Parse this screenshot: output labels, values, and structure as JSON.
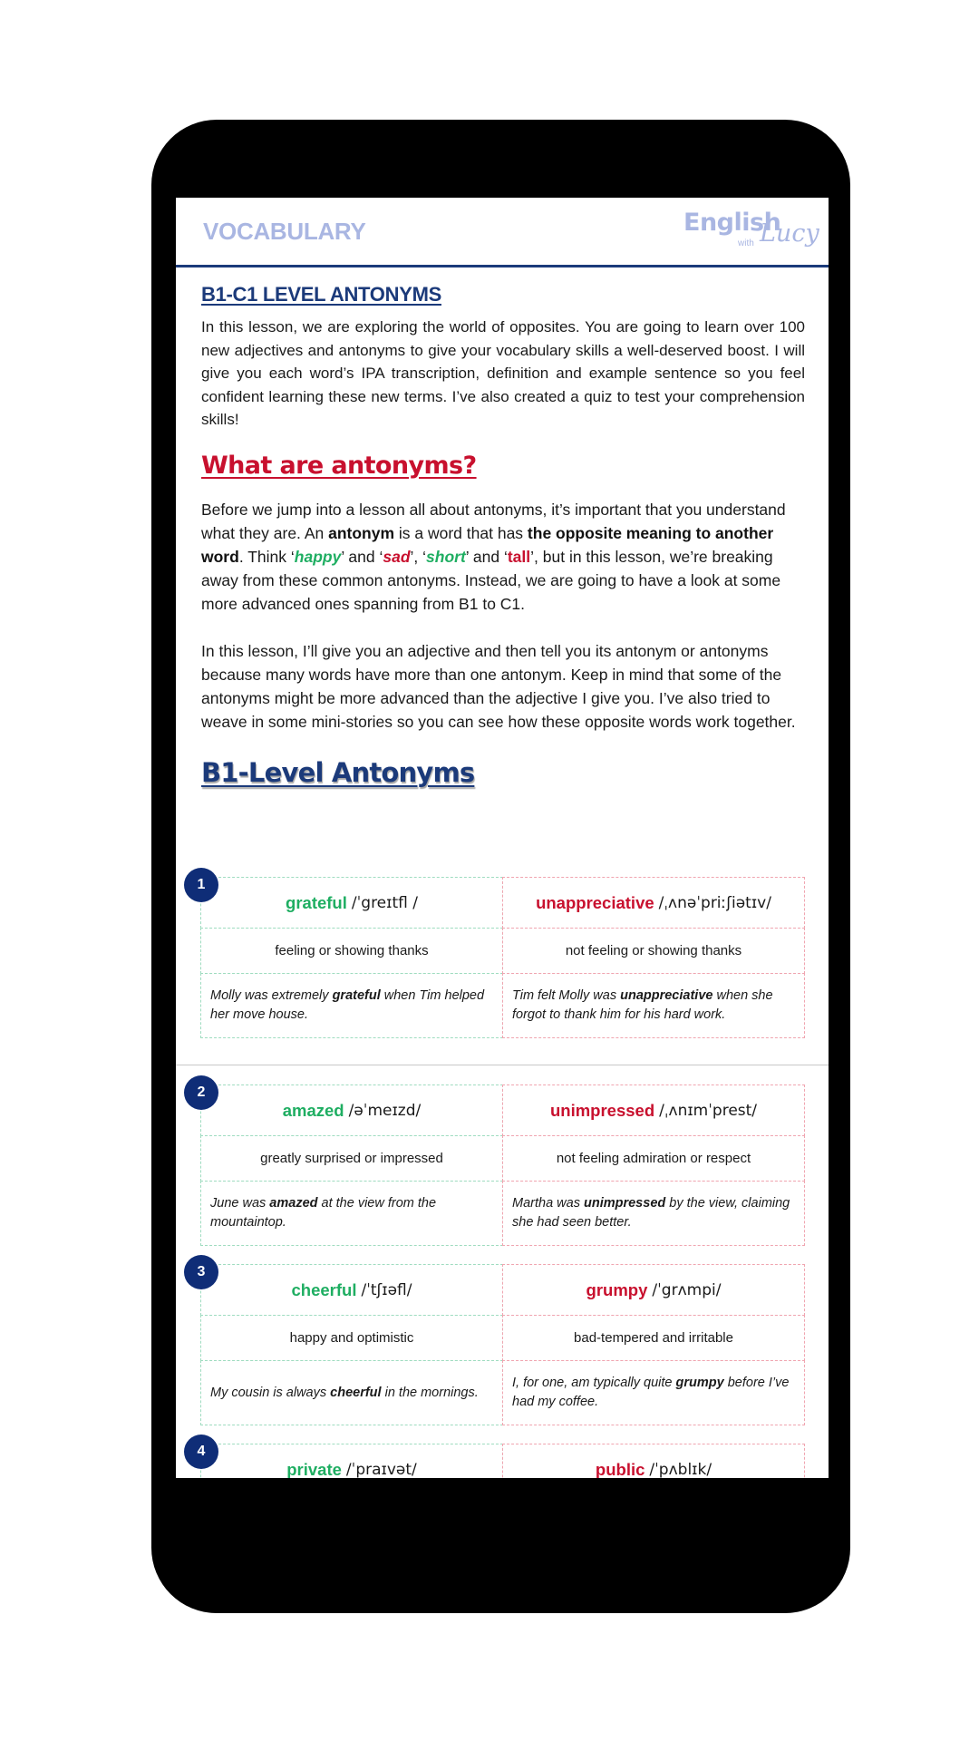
{
  "header": {
    "title": "VOCABULARY",
    "logo": {
      "main": "English",
      "small": "with",
      "script": "Lucy"
    }
  },
  "intro": {
    "heading": "B1-C1 LEVEL ANTONYMS",
    "text": "In this lesson, we are exploring the world of opposites. You are going to learn over 100 new adjectives and antonyms to give your vocabulary skills a well-deserved boost. I will give you each word’s IPA transcription, definition and example sentence so you feel confident learning these new terms. I’ve also created a quiz to test your comprehension skills!"
  },
  "what": {
    "heading": "What are antonyms?",
    "p1": {
      "t1": "Before we jump into a lesson all about antonyms, it’s important that you understand what they are. An ",
      "b1": "antonym",
      "t2": " is a word that has ",
      "b2": "the opposite meaning to another word",
      "t3": ". Think ‘",
      "w1": "happy",
      "t4": "’ and ‘",
      "w2": "sad",
      "t5": "’, ‘",
      "w3": "short",
      "t6": "’ and ‘",
      "w4": "tall",
      "t7": "’, but in this lesson, we’re breaking away from these common antonyms. Instead, we are going to have a look at some more advanced ones spanning from B1 to C1."
    },
    "p2": "In this lesson, I’ll give you an adjective and then tell you its antonym or antonyms because many words have more than one antonym. Keep in mind that some of the antonyms might be more advanced than the adjective I give you. I’ve also tried to weave in some mini-stories so you can see how these opposite words work together."
  },
  "b1_heading": "B1-Level Antonyms",
  "colors": {
    "accent_blue": "#1b3a7a",
    "green": "#1fae62",
    "red": "#c8102e",
    "badge": "#0f2d77",
    "header_title": "#a9b6e2"
  },
  "cards": [
    {
      "number": "1",
      "left": {
        "word": "grateful",
        "ipa": "/ˈgreɪtfl /",
        "definition": "feeling or showing thanks",
        "ex_pre": "Molly was extremely ",
        "ex_word": "grateful",
        "ex_post": " when Tim helped her move house."
      },
      "right": {
        "word": "unappreciative",
        "ipa": "/ˌʌnəˈpriːʃiətɪv/",
        "definition": "not feeling or showing thanks",
        "ex_pre": "Tim felt Molly was ",
        "ex_word": "unappreciative",
        "ex_post": " when she forgot to thank him for his hard work."
      }
    },
    {
      "number": "2",
      "left": {
        "word": "amazed",
        "ipa": "/əˈmeɪzd/",
        "definition": "greatly surprised or impressed",
        "ex_pre": "June was ",
        "ex_word": "amazed",
        "ex_post": " at the view from the mountaintop."
      },
      "right": {
        "word": "unimpressed",
        "ipa": "/ˌʌnɪmˈprest/",
        "definition": "not feeling admiration or respect",
        "ex_pre": "Martha was ",
        "ex_word": "unimpressed",
        "ex_post": " by the view, claiming she had seen better."
      }
    },
    {
      "number": "3",
      "left": {
        "word": "cheerful",
        "ipa": "/ˈtʃɪəfl/",
        "definition": "happy and optimistic",
        "ex_pre": "My cousin is always ",
        "ex_word": "cheerful",
        "ex_post": " in the mornings."
      },
      "right": {
        "word": "grumpy",
        "ipa": "/ˈgrʌmpi/",
        "definition": "bad-tempered and irritable",
        "ex_pre": "I, for one, am typically quite ",
        "ex_word": "grumpy",
        "ex_post": " before I’ve had my coffee."
      }
    },
    {
      "number": "4",
      "left": {
        "word": "private",
        "ipa": "/ˈpraɪvət/"
      },
      "right": {
        "word": "public",
        "ipa": "/ˈpʌblɪk/"
      }
    }
  ]
}
